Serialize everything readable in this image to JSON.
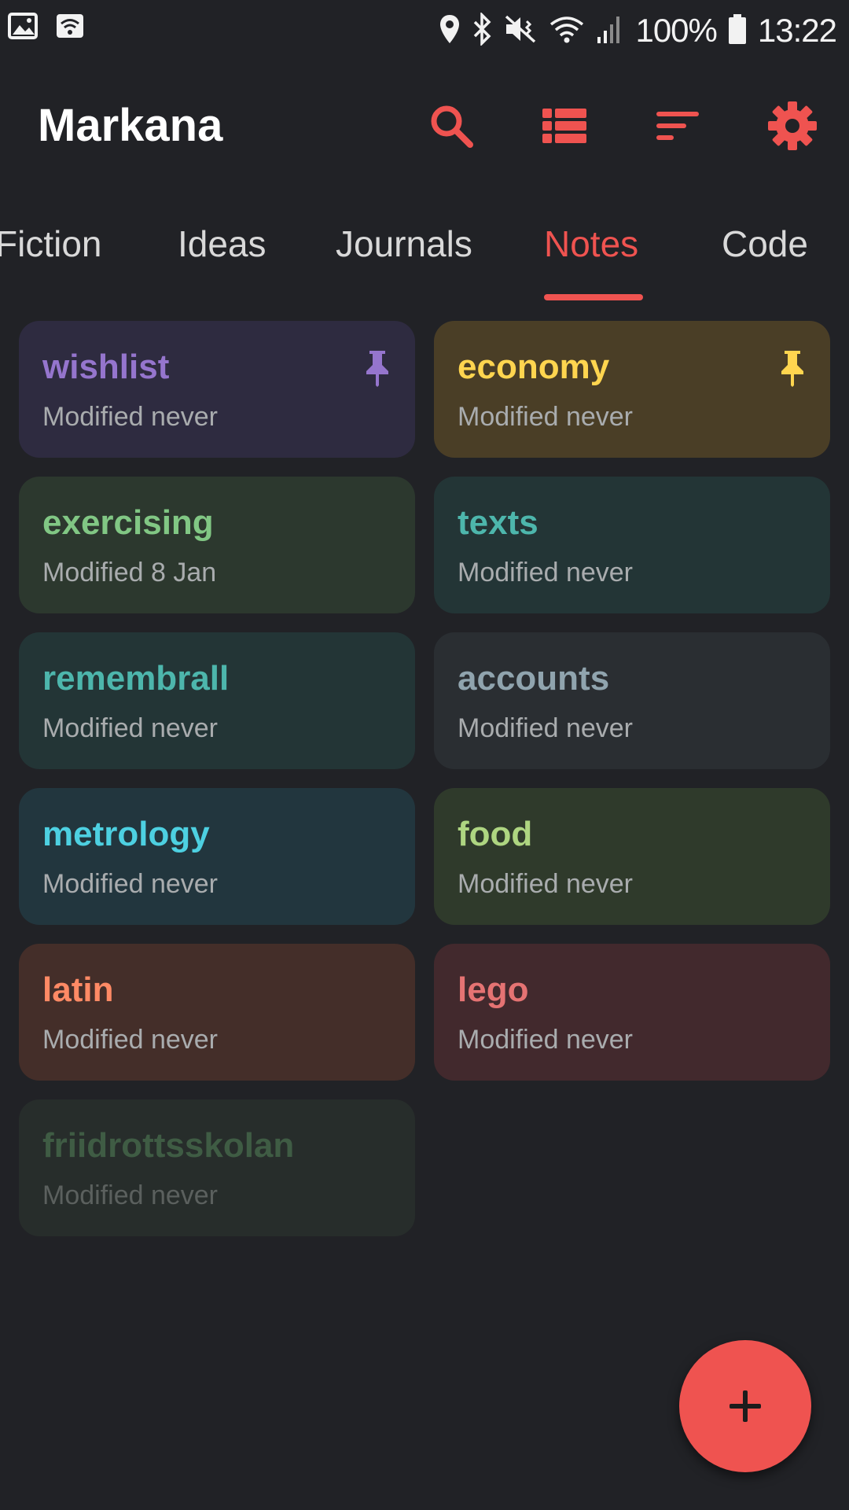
{
  "status_bar": {
    "battery": "100%",
    "time": "13:22",
    "icons": [
      "gallery-icon",
      "wifi-icon",
      "location-icon",
      "bluetooth-icon",
      "mute-vibrate-icon",
      "wifi-signal-icon",
      "cell-signal-icon",
      "battery-icon"
    ]
  },
  "app": {
    "title": "Markana",
    "accent": "#ef5350",
    "actions": [
      "search-icon",
      "view-list-icon",
      "sort-icon",
      "settings-icon"
    ]
  },
  "tabs": [
    {
      "label": "Fiction"
    },
    {
      "label": "Ideas"
    },
    {
      "label": "Journals"
    },
    {
      "label": "Notes",
      "active": true
    },
    {
      "label": "Code"
    }
  ],
  "notes": [
    {
      "title": "wishlist",
      "modified": "Modified never",
      "pinned": true,
      "title_color": "#9575cd",
      "bg": "#2e2b40",
      "pin_color": "#9575cd"
    },
    {
      "title": "economy",
      "modified": "Modified never",
      "pinned": true,
      "title_color": "#ffd54f",
      "bg": "#4a3e26",
      "pin_color": "#ffd54f"
    },
    {
      "title": "exercising",
      "modified": "Modified 8 Jan",
      "pinned": false,
      "title_color": "#81c784",
      "bg": "#2c382e"
    },
    {
      "title": "texts",
      "modified": "Modified never",
      "pinned": false,
      "title_color": "#4db6ac",
      "bg": "#233536"
    },
    {
      "title": "remembrall",
      "modified": "Modified never",
      "pinned": false,
      "title_color": "#4db6ac",
      "bg": "#233536"
    },
    {
      "title": "accounts",
      "modified": "Modified never",
      "pinned": false,
      "title_color": "#90a4ae",
      "bg": "#2a2e32"
    },
    {
      "title": "metrology",
      "modified": "Modified never",
      "pinned": false,
      "title_color": "#4dd0e1",
      "bg": "#22363e"
    },
    {
      "title": "food",
      "modified": "Modified never",
      "pinned": false,
      "title_color": "#aed581",
      "bg": "#2f3a2b"
    },
    {
      "title": "latin",
      "modified": "Modified never",
      "pinned": false,
      "title_color": "#ff8a65",
      "bg": "#442e29"
    },
    {
      "title": "lego",
      "modified": "Modified never",
      "pinned": false,
      "title_color": "#e57373",
      "bg": "#42292d"
    },
    {
      "title": "friidrottsskolan",
      "modified": "Modified never",
      "pinned": false,
      "title_color": "#3f5c44",
      "bg": "#272d2b",
      "sub_color": "#5b605e"
    }
  ],
  "fab": {
    "icon": "plus-icon"
  }
}
